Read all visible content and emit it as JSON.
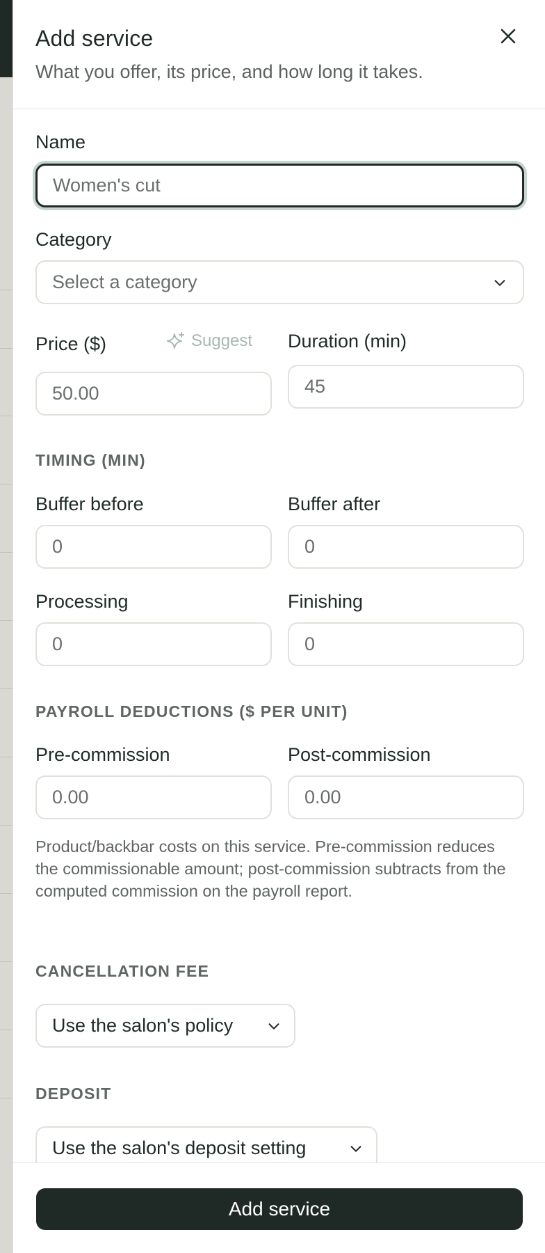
{
  "dialog": {
    "title": "Add service",
    "subtitle": "What you offer, its price, and how long it takes.",
    "close_icon": "close-icon"
  },
  "fields": {
    "name": {
      "label": "Name",
      "value": "Women's cut"
    },
    "category": {
      "label": "Category",
      "placeholder": "Select a category"
    },
    "price": {
      "label": "Price ($)",
      "value": "50.00",
      "suggest_label": "Suggest",
      "suggest_icon": "sparkle-icon"
    },
    "duration": {
      "label": "Duration (min)",
      "value": "45"
    }
  },
  "timing": {
    "section_title": "TIMING (MIN)",
    "buffer_before": {
      "label": "Buffer before",
      "value": "0"
    },
    "buffer_after": {
      "label": "Buffer after",
      "value": "0"
    },
    "processing": {
      "label": "Processing",
      "value": "0"
    },
    "finishing": {
      "label": "Finishing",
      "value": "0"
    }
  },
  "payroll": {
    "section_title": "PAYROLL DEDUCTIONS ($ PER UNIT)",
    "pre_commission": {
      "label": "Pre-commission",
      "value": "0.00"
    },
    "post_commission": {
      "label": "Post-commission",
      "value": "0.00"
    },
    "help_text": "Product/backbar costs on this service. Pre-commission reduces the commissionable amount; post-commission subtracts from the computed commission on the payroll report."
  },
  "cancellation": {
    "section_title": "CANCELLATION FEE",
    "selected": "Use the salon's policy"
  },
  "deposit": {
    "section_title": "DEPOSIT",
    "selected": "Use the salon's deposit setting"
  },
  "footer": {
    "submit_label": "Add service"
  },
  "colors": {
    "primary": "#1f2a26",
    "accent_suggest": "#a7b9b1",
    "border": "#e1e0da",
    "focus_ring": "#c6d6cf"
  }
}
